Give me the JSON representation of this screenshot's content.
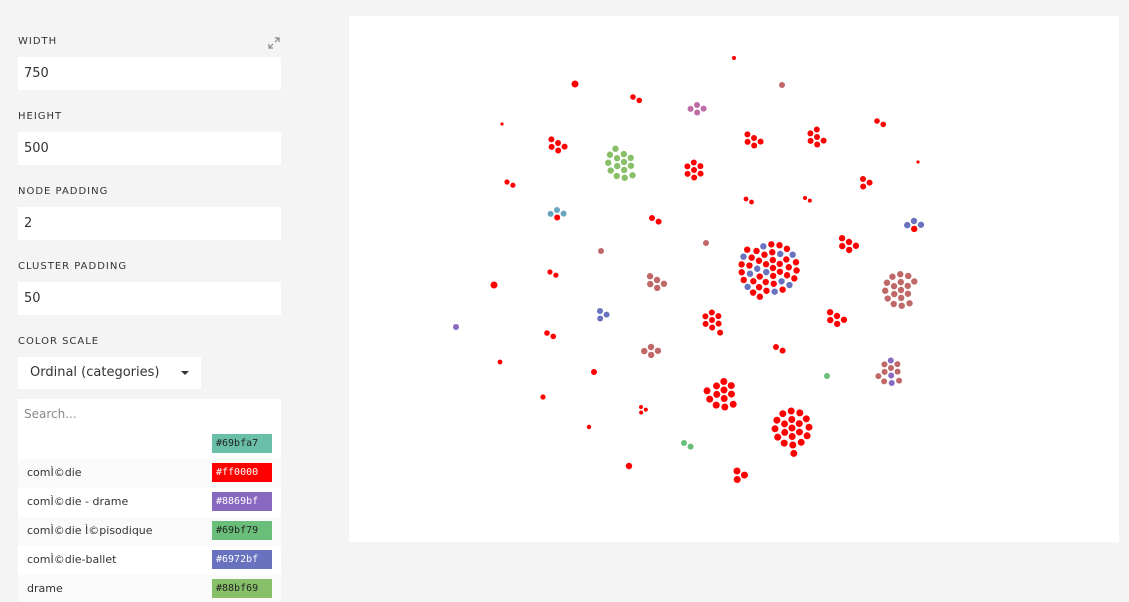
{
  "sidebar": {
    "width_label": "WIDTH",
    "width_value": "750",
    "height_label": "HEIGHT",
    "height_value": "500",
    "node_padding_label": "NODE PADDING",
    "node_padding_value": "2",
    "cluster_padding_label": "CLUSTER PADDING",
    "cluster_padding_value": "50",
    "color_scale_label": "COLOR SCALE",
    "color_scale_value": "Ordinal (categories)",
    "search_placeholder": "Search...",
    "expand_icon": "expand-icon",
    "color_items": [
      {
        "label": "",
        "hex": "#69bfa7"
      },
      {
        "label": "comÌ©die",
        "hex": "#ff0000"
      },
      {
        "label": "comÌ©die - drame",
        "hex": "#8869bf"
      },
      {
        "label": "comÌ©die Ì©pisodique",
        "hex": "#69bf79"
      },
      {
        "label": "comÌ©die-ballet",
        "hex": "#6972bf"
      },
      {
        "label": "drame",
        "hex": "#88bf69"
      }
    ]
  },
  "graph": {
    "palette": {
      "red": "#ff0000",
      "rose": "#c06868",
      "green": "#88bf69",
      "teal": "#69a5bf",
      "blue": "#6972bf",
      "purple": "#8869bf",
      "pink": "#bf69a5",
      "lightgreen": "#69bf79"
    }
  }
}
